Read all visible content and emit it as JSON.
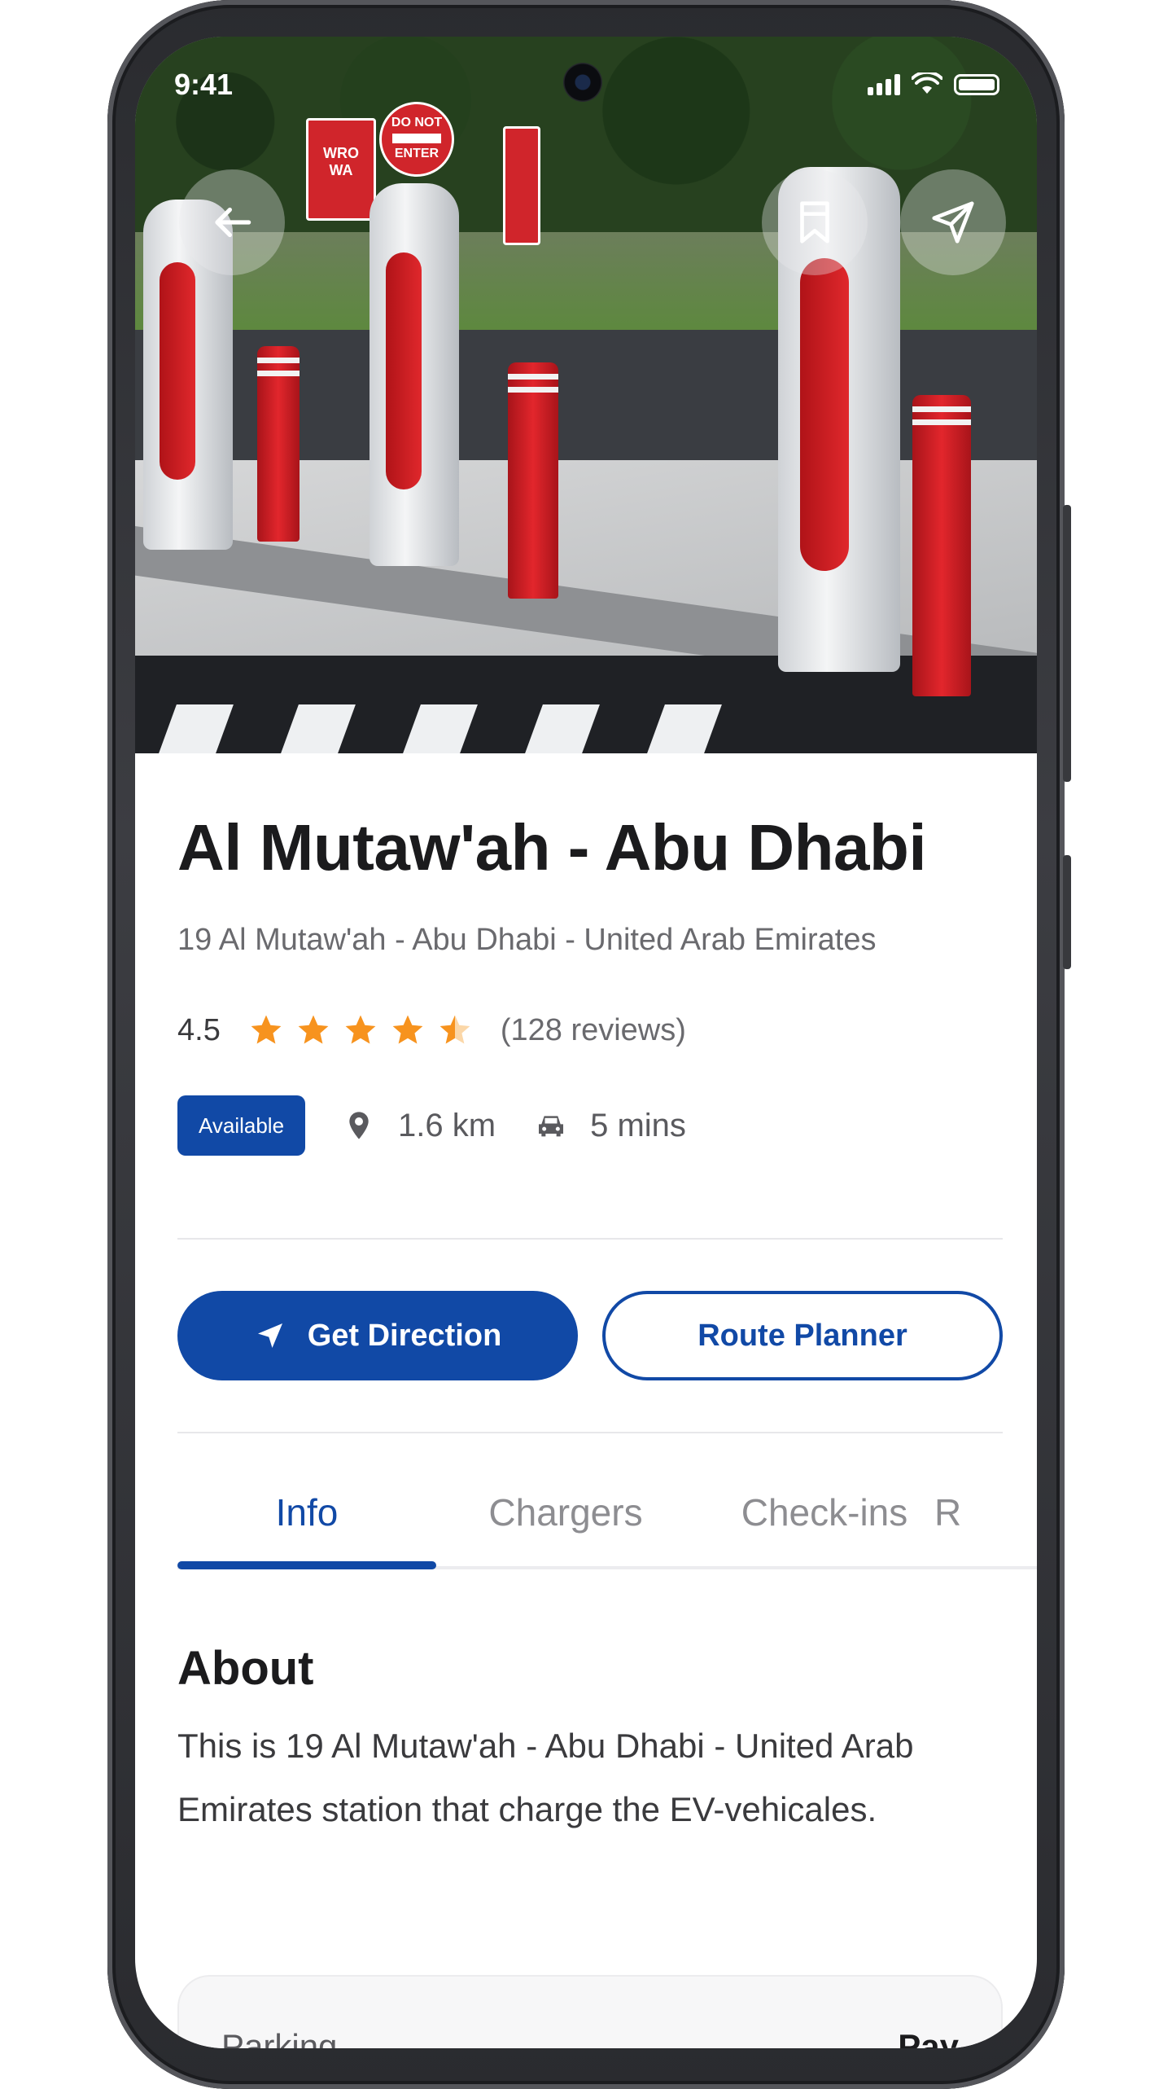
{
  "status_bar": {
    "time": "9:41"
  },
  "hero": {
    "back_icon": "arrow-left-icon",
    "bookmark_icon": "bookmark-icon",
    "share_icon": "send-icon",
    "sign_text_1": "DO NOT",
    "sign_text_2": "ENTER",
    "sign_text_3": "WRO",
    "sign_text_4": "WA"
  },
  "station": {
    "name": "Al Mutaw'ah - Abu Dhabi",
    "address": "19 Al Mutaw'ah - Abu Dhabi - United Arab Emirates",
    "rating": "4.5",
    "rating_value": 4.5,
    "rating_max": 5,
    "reviews": "(128 reviews)",
    "availability": "Available",
    "distance": "1.6 km",
    "drive_time": "5 mins"
  },
  "actions": {
    "get_direction": "Get Direction",
    "route_planner": "Route Planner"
  },
  "tabs": [
    "Info",
    "Chargers",
    "Check-ins",
    "R"
  ],
  "active_tab": "Info",
  "about": {
    "title": "About",
    "text": "This is 19 Al Mutaw'ah - Abu Dhabi - United Arab Emirates station that charge the EV-vehicales."
  },
  "details": {
    "parking_label": "Parking",
    "parking_value": "Pay"
  },
  "colors": {
    "primary": "#1149a6",
    "star": "#f7931e",
    "text_dark": "#1b1b1d",
    "text_muted": "#6a6a6e"
  }
}
